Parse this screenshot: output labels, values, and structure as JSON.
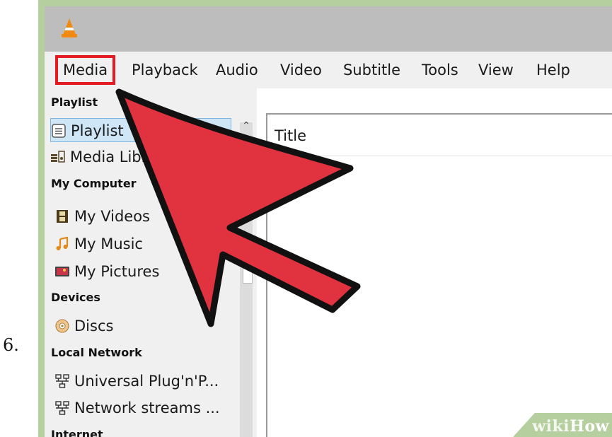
{
  "step_number": "6.",
  "window": {
    "app_icon": "vlc-cone-icon"
  },
  "menu": {
    "items": [
      "Media",
      "Playback",
      "Audio",
      "Video",
      "Subtitle",
      "Tools",
      "View",
      "Help"
    ],
    "highlighted": "Media"
  },
  "sidebar": {
    "sections": [
      {
        "heading": "Playlist",
        "items": [
          {
            "label": "Playlist",
            "icon": "playlist-icon",
            "selected": true
          },
          {
            "label": "Media Library",
            "icon": "media-library-icon"
          }
        ]
      },
      {
        "heading": "My Computer",
        "items": [
          {
            "label": "My Videos",
            "icon": "film-icon"
          },
          {
            "label": "My Music",
            "icon": "music-note-icon"
          },
          {
            "label": "My Pictures",
            "icon": "picture-icon"
          }
        ]
      },
      {
        "heading": "Devices",
        "items": [
          {
            "label": "Discs",
            "icon": "disc-icon"
          }
        ]
      },
      {
        "heading": "Local Network",
        "items": [
          {
            "label": "Universal Plug'n'P...",
            "icon": "network-icon"
          },
          {
            "label": "Network streams ...",
            "icon": "network-icon"
          }
        ]
      },
      {
        "heading": "Internet",
        "items": []
      }
    ]
  },
  "playlist": {
    "column_header": "Title"
  },
  "watermark": {
    "part1": "wiki",
    "part2": "How"
  },
  "colors": {
    "highlight_box": "#e31b23",
    "arrow_fill": "#e0323f",
    "watermark_bg": "#b5cf9f"
  }
}
